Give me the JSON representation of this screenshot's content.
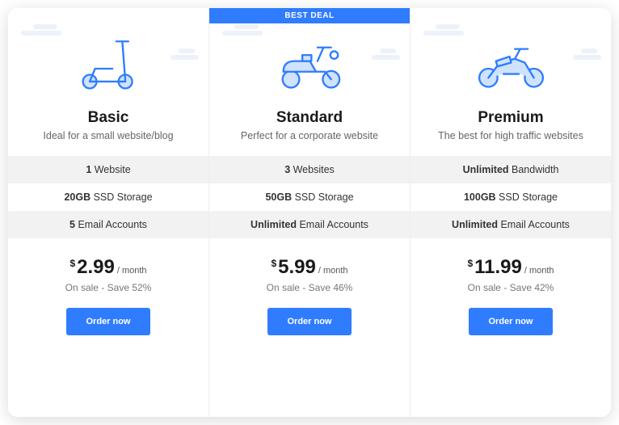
{
  "plans": [
    {
      "name": "Basic",
      "desc": "Ideal for a small website/blog",
      "badge": "",
      "features": [
        {
          "bold": "1",
          "text": " Website"
        },
        {
          "bold": "20GB",
          "text": " SSD Storage"
        },
        {
          "bold": "5",
          "text": " Email Accounts"
        }
      ],
      "currency": "$",
      "price": "2.99",
      "period": "/ month",
      "sale": "On sale - Save 52%",
      "cta": "Order now"
    },
    {
      "name": "Standard",
      "desc": "Perfect for a corporate website",
      "badge": "BEST DEAL",
      "features": [
        {
          "bold": "3",
          "text": " Websites"
        },
        {
          "bold": "50GB",
          "text": " SSD Storage"
        },
        {
          "bold": "Unlimited",
          "text": " Email Accounts"
        }
      ],
      "currency": "$",
      "price": "5.99",
      "period": "/ month",
      "sale": "On sale - Save 46%",
      "cta": "Order now"
    },
    {
      "name": "Premium",
      "desc": "The best for high traffic websites",
      "badge": "",
      "features": [
        {
          "bold": "Unlimited",
          "text": " Bandwidth"
        },
        {
          "bold": "100GB",
          "text": " SSD Storage"
        },
        {
          "bold": "Unlimited",
          "text": " Email Accounts"
        }
      ],
      "currency": "$",
      "price": "11.99",
      "period": "/ month",
      "sale": "On sale - Save 42%",
      "cta": "Order now"
    }
  ]
}
